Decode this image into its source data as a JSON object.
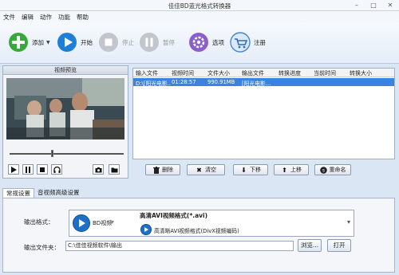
{
  "window": {
    "title": "佳佳BD蓝光格式转换器",
    "controls": [
      "–",
      "□",
      "✕"
    ]
  },
  "menu": [
    "文件",
    "编辑",
    "动作",
    "功能",
    "帮助"
  ],
  "toolbar": {
    "add_label": "添加",
    "start_label": "开始",
    "stop_label": "停止",
    "pause_label": "暂停",
    "options_label": "选项",
    "register_label": "注册"
  },
  "preview": {
    "title": "视频预览"
  },
  "file_list": {
    "columns": [
      "输入文件",
      "视频时间",
      "文件大小",
      "输出文件",
      "转换进度",
      "当前时间",
      "转换大小"
    ],
    "rows": [
      {
        "input": "D:\\[阳光电影...",
        "duration": "01:28:57",
        "size": "990.91MB",
        "output": "[阳光电影...",
        "progress": "",
        "current": "",
        "converted": ""
      }
    ]
  },
  "list_buttons": {
    "delete": "删除",
    "clear": "清空",
    "down": "下移",
    "up": "上移",
    "rename": "重命名"
  },
  "tabs": [
    "常规设置",
    "音视频高级设置"
  ],
  "settings": {
    "format_label": "输出格式：",
    "format_category": "BD视频",
    "format_name": "高清AVI视频格式(*.avi)",
    "format_desc": "高清晰AVI视频格式(DivX视频编码)",
    "folder_label": "输出文件夹：",
    "folder_value": "C:\\佳佳视频软件\\输出",
    "browse_label": "浏览...",
    "open_label": "打开"
  },
  "colors": {
    "accent": "#3b83e0",
    "add": "#37a83a",
    "start": "#1f7fd6",
    "options": "#8b5fc9"
  }
}
